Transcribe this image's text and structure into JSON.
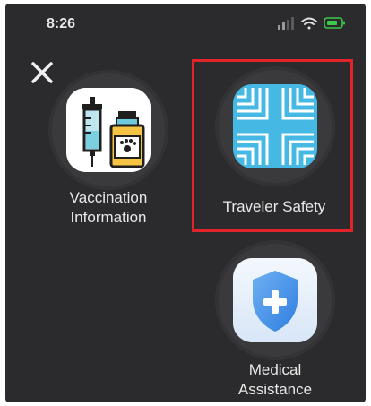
{
  "status_bar": {
    "time": "8:26",
    "icons": [
      "signal-icon",
      "wifi-icon",
      "battery-icon"
    ],
    "battery_color": "#3cc84a"
  },
  "colors": {
    "background": "#2b2b2d",
    "highlight": "#e2232a",
    "tile": "#3a3a3c"
  },
  "tiles": [
    {
      "label_line1": "Vaccination",
      "label_line2": "Information",
      "icon": "vaccination-icon"
    },
    {
      "label_line1": "Traveler Safety",
      "icon": "traveler-safety-icon",
      "highlighted": true
    },
    {
      "label_line1": "Medical",
      "label_line2": "Assistance",
      "icon": "medical-assistance-icon"
    }
  ]
}
